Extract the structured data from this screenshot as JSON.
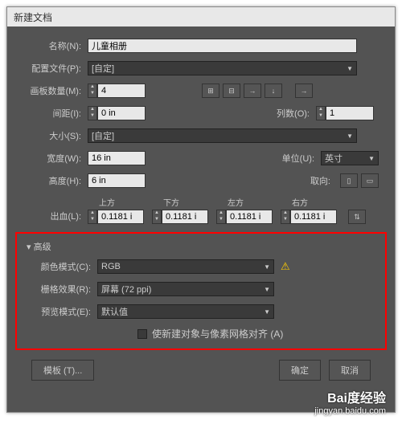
{
  "title": "新建文档",
  "name": {
    "label": "名称(N):",
    "value": "儿童相册"
  },
  "profile": {
    "label": "配置文件(P):",
    "value": "[自定]"
  },
  "artboards": {
    "label": "画板数量(M):",
    "value": "4"
  },
  "spacing": {
    "label": "间距(I):",
    "value": "0 in"
  },
  "columns": {
    "label": "列数(O):",
    "value": "1"
  },
  "size": {
    "label": "大小(S):",
    "value": "[自定]"
  },
  "width": {
    "label": "宽度(W):",
    "value": "16 in"
  },
  "units": {
    "label": "单位(U):",
    "value": "英寸"
  },
  "height": {
    "label": "高度(H):",
    "value": "6 in"
  },
  "orientation": {
    "label": "取向:"
  },
  "bleed": {
    "label": "出血(L):",
    "top": "上方",
    "bottom": "下方",
    "left": "左方",
    "right": "右方",
    "value": "0.1181 i"
  },
  "advanced": {
    "title": "▾ 高级",
    "colormode": {
      "label": "颜色模式(C):",
      "value": "RGB"
    },
    "raster": {
      "label": "栅格效果(R):",
      "value": "屏幕 (72 ppi)"
    },
    "preview": {
      "label": "预览模式(E):",
      "value": "默认值"
    },
    "align": "使新建对象与像素网格对齐 (A)"
  },
  "buttons": {
    "template": "模板 (T)...",
    "ok": "确定",
    "cancel": "取消"
  },
  "watermark": {
    "logo": "Bai度经验",
    "url": "jingyan.baidu.com"
  }
}
